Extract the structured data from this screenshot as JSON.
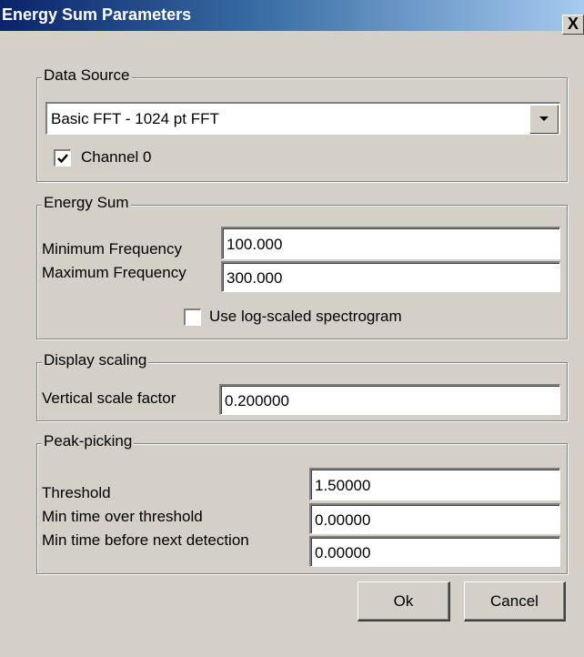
{
  "window": {
    "title": "Energy Sum Parameters",
    "close_label": "X"
  },
  "data_source": {
    "legend": "Data Source",
    "selected": "Basic FFT - 1024 pt FFT",
    "channel_label": "Channel 0",
    "channel_checked": true
  },
  "energy_sum": {
    "legend": "Energy Sum",
    "min_freq_label": "Minimum Frequency",
    "min_freq_value": "100.000",
    "max_freq_label": "Maximum Frequency",
    "max_freq_value": "300.000",
    "log_scaled_label": "Use log-scaled spectrogram",
    "log_scaled_checked": false
  },
  "display_scaling": {
    "legend": "Display scaling",
    "vertical_label": "Vertical scale factor",
    "vertical_value": "0.200000"
  },
  "peak_picking": {
    "legend": "Peak-picking",
    "threshold_label": "Threshold",
    "threshold_value": "1.50000",
    "min_time_label": "Min time over threshold",
    "min_time_value": "0.00000",
    "min_before_label": "Min time before next detection",
    "min_before_value": "0.00000"
  },
  "buttons": {
    "ok": "Ok",
    "cancel": "Cancel"
  },
  "colors": {
    "title_start": "#0a246a",
    "title_end": "#a6caf0",
    "face": "#d4d0c8"
  }
}
